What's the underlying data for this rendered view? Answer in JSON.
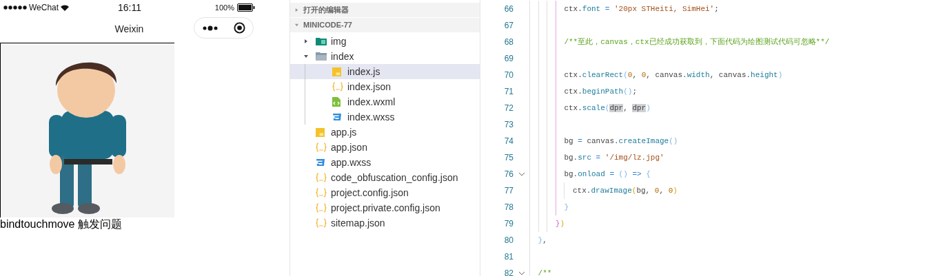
{
  "phone": {
    "status_bar": {
      "carrier": "WeChat",
      "time": "16:11",
      "battery": "100%"
    },
    "nav_title": "Weixin",
    "caption": "bindtouchmove 触发问题"
  },
  "explorer": {
    "sections": [
      {
        "label": "打开的编辑器",
        "expanded": false
      },
      {
        "label": "MINICODE-77",
        "expanded": true,
        "children": [
          {
            "kind": "folder-image",
            "label": "img",
            "expanded": false,
            "selected": false
          },
          {
            "kind": "folder",
            "label": "index",
            "expanded": true,
            "selected": false,
            "children": [
              {
                "kind": "js",
                "label": "index.js",
                "selected": true
              },
              {
                "kind": "json",
                "label": "index.json",
                "selected": false
              },
              {
                "kind": "wxml",
                "label": "index.wxml",
                "selected": false
              },
              {
                "kind": "wxss",
                "label": "index.wxss",
                "selected": false
              }
            ]
          },
          {
            "kind": "js",
            "label": "app.js",
            "selected": false
          },
          {
            "kind": "json",
            "label": "app.json",
            "selected": false
          },
          {
            "kind": "wxss",
            "label": "app.wxss",
            "selected": false
          },
          {
            "kind": "json",
            "label": "code_obfuscation_config.json",
            "selected": false
          },
          {
            "kind": "json",
            "label": "project.config.json",
            "selected": false
          },
          {
            "kind": "json",
            "label": "project.private.config.json",
            "selected": false
          },
          {
            "kind": "json",
            "label": "sitemap.json",
            "selected": false
          }
        ]
      }
    ]
  },
  "editor": {
    "lines": [
      {
        "children": [
          {
            "children": [
              {
                "children": [
                  {
                    "number": "66",
                    "fold": false,
                    "tokens": [
                      {
                        "kind": "plain",
                        "text": "ctx."
                      },
                      {
                        "kind": "prop",
                        "text": "font"
                      },
                      {
                        "kind": "op",
                        "text": " = "
                      },
                      {
                        "kind": "str",
                        "text": "'20px STHeiti, SimHei'"
                      },
                      {
                        "kind": "plain",
                        "text": ";"
                      }
                    ]
                  },
                  {
                    "number": "67",
                    "fold": false
                  },
                  {
                    "number": "68",
                    "fold": false,
                    "tokens": [
                      {
                        "kind": "comment",
                        "text": "/**至此，canvas，ctx已经成功获取到，下面代码为绘图测试代码可忽略**/"
                      }
                    ]
                  },
                  {
                    "number": "69",
                    "fold": false
                  },
                  {
                    "number": "70",
                    "fold": false,
                    "tokens": [
                      {
                        "kind": "plain",
                        "text": "ctx."
                      },
                      {
                        "kind": "prop",
                        "text": "clearRect"
                      },
                      {
                        "kind": "b1",
                        "text": "("
                      },
                      {
                        "kind": "num",
                        "text": "0"
                      },
                      {
                        "kind": "plain",
                        "text": ", "
                      },
                      {
                        "kind": "num",
                        "text": "0"
                      },
                      {
                        "kind": "plain",
                        "text": ", canvas."
                      },
                      {
                        "kind": "prop",
                        "text": "width"
                      },
                      {
                        "kind": "plain",
                        "text": ", canvas."
                      },
                      {
                        "kind": "prop",
                        "text": "height"
                      },
                      {
                        "kind": "b1",
                        "text": ")"
                      }
                    ]
                  },
                  {
                    "number": "71",
                    "fold": false,
                    "tokens": [
                      {
                        "kind": "plain",
                        "text": "ctx."
                      },
                      {
                        "kind": "prop",
                        "text": "beginPath"
                      },
                      {
                        "kind": "b1",
                        "text": "()"
                      },
                      {
                        "kind": "plain",
                        "text": ";"
                      }
                    ]
                  },
                  {
                    "number": "72",
                    "fold": false,
                    "tokens": [
                      {
                        "kind": "plain",
                        "text": "ctx."
                      },
                      {
                        "kind": "prop",
                        "text": "scale"
                      },
                      {
                        "kind": "b1",
                        "text": "("
                      },
                      {
                        "kind": "hl",
                        "text": "dpr"
                      },
                      {
                        "kind": "plain",
                        "text": ", "
                      },
                      {
                        "kind": "hl",
                        "text": "dpr"
                      },
                      {
                        "kind": "b1",
                        "text": ")"
                      }
                    ]
                  },
                  {
                    "number": "73",
                    "fold": false
                  },
                  {
                    "number": "74",
                    "fold": false,
                    "tokens": [
                      {
                        "kind": "plain",
                        "text": "bg "
                      },
                      {
                        "kind": "op",
                        "text": "="
                      },
                      {
                        "kind": "plain",
                        "text": " canvas."
                      },
                      {
                        "kind": "prop",
                        "text": "createImage"
                      },
                      {
                        "kind": "b1",
                        "text": "()"
                      }
                    ]
                  },
                  {
                    "number": "75",
                    "fold": false,
                    "tokens": [
                      {
                        "kind": "plain",
                        "text": "bg."
                      },
                      {
                        "kind": "prop",
                        "text": "src"
                      },
                      {
                        "kind": "op",
                        "text": " = "
                      },
                      {
                        "kind": "str",
                        "text": "'/img/lz.jpg'"
                      }
                    ]
                  },
                  {
                    "number": "76",
                    "fold": true,
                    "tokens": [
                      {
                        "kind": "plain",
                        "text": "bg."
                      },
                      {
                        "kind": "prop",
                        "text": "onload"
                      },
                      {
                        "kind": "op",
                        "text": " = "
                      },
                      {
                        "kind": "b1",
                        "text": "()"
                      },
                      {
                        "kind": "op",
                        "text": " => "
                      },
                      {
                        "kind": "b1",
                        "text": "{"
                      }
                    ],
                    "children": [
                      {
                        "number": "77",
                        "fold": false,
                        "tokens": [
                          {
                            "kind": "plain",
                            "text": "ctx."
                          },
                          {
                            "kind": "prop",
                            "text": "drawImage"
                          },
                          {
                            "kind": "b2",
                            "text": "("
                          },
                          {
                            "kind": "plain",
                            "text": "bg, "
                          },
                          {
                            "kind": "num",
                            "text": "0"
                          },
                          {
                            "kind": "plain",
                            "text": ", "
                          },
                          {
                            "kind": "num",
                            "text": "0"
                          },
                          {
                            "kind": "b2",
                            "text": ")"
                          }
                        ]
                      }
                    ]
                  },
                  {
                    "number": "78",
                    "fold": false,
                    "tokens": [
                      {
                        "kind": "b1",
                        "text": "}"
                      }
                    ]
                  }
                ]
              },
              {
                "number": "79",
                "fold": false,
                "tokens": [
                  {
                    "kind": "b3",
                    "text": "}"
                  },
                  {
                    "kind": "b2",
                    "text": ")"
                  }
                ]
              }
            ]
          }
        ]
      },
      {
        "number": "80",
        "fold": false,
        "tokens": [
          {
            "kind": "b1",
            "text": "}"
          },
          {
            "kind": "plain",
            "text": ","
          }
        ]
      },
      {
        "number": "81",
        "fold": false
      },
      {
        "number": "82",
        "fold": true,
        "tokens": [
          {
            "kind": "comment",
            "text": "/**"
          }
        ]
      }
    ]
  }
}
